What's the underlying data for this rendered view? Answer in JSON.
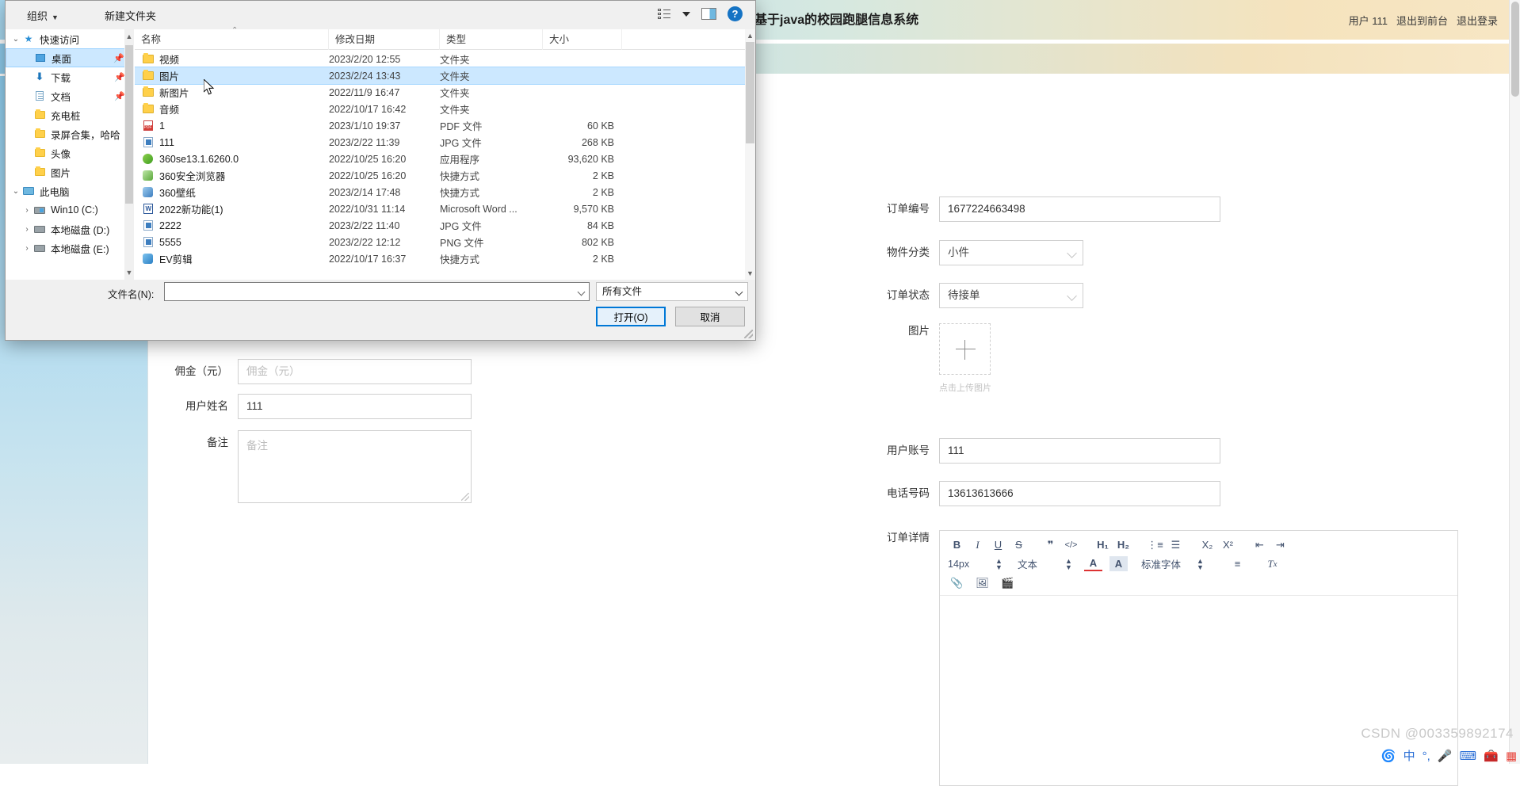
{
  "webpage": {
    "title": "基于java的校园跑腿信息系统",
    "user_label": "用户 111",
    "logout_front": "退出到前台",
    "logout": "退出登录",
    "form_left": {
      "commission_label": "佣金（元）",
      "commission_placeholder": "佣金（元）",
      "commission_value": "",
      "username_label": "用户姓名",
      "username_value": "111",
      "remark_label": "备注",
      "remark_placeholder": "备注",
      "remark_value": ""
    },
    "form_right": {
      "order_no_label": "订单编号",
      "order_no_value": "1677224663498",
      "category_label": "物件分类",
      "category_value": "小件",
      "status_label": "订单状态",
      "status_value": "待接单",
      "image_label": "图片",
      "upload_hint": "点击上传图片",
      "account_label": "用户账号",
      "account_value": "111",
      "phone_label": "电话号码",
      "phone_value": "13613613666",
      "detail_label": "订单详情"
    },
    "editor_toolbar": {
      "row1": [
        "B",
        "I",
        "U",
        "S",
        "❞",
        "</>",
        "H₁",
        "H₂",
        "⋮≡",
        "☰",
        "X₂",
        "X²",
        "⇤",
        "⇥"
      ],
      "font_size": "14px",
      "block_type": "文本",
      "font_family": "标准字体",
      "row3": [
        "paperclip-icon",
        "image-icon",
        "video-icon"
      ]
    }
  },
  "dialog": {
    "toolbar": {
      "organize": "组织",
      "new_folder": "新建文件夹"
    },
    "nav_items": [
      {
        "label": "快速访问",
        "icon": "star-icon",
        "chevron": "⌄",
        "indent": 0,
        "pinned": false,
        "selected": false
      },
      {
        "label": "桌面",
        "icon": "desktop-icon",
        "chevron": "",
        "indent": 1,
        "pinned": true,
        "selected": true
      },
      {
        "label": "下载",
        "icon": "download-icon",
        "chevron": "",
        "indent": 1,
        "pinned": true,
        "selected": false
      },
      {
        "label": "文档",
        "icon": "document-icon",
        "chevron": "",
        "indent": 1,
        "pinned": true,
        "selected": false
      },
      {
        "label": "充电桩",
        "icon": "folder-icon",
        "chevron": "",
        "indent": 1,
        "pinned": false,
        "selected": false
      },
      {
        "label": "录屏合集，哈哈",
        "icon": "folder-icon",
        "chevron": "",
        "indent": 1,
        "pinned": false,
        "selected": false
      },
      {
        "label": "头像",
        "icon": "folder-icon",
        "chevron": "",
        "indent": 1,
        "pinned": false,
        "selected": false
      },
      {
        "label": "图片",
        "icon": "folder-icon",
        "chevron": "",
        "indent": 1,
        "pinned": false,
        "selected": false
      },
      {
        "label": "此电脑",
        "icon": "pc-icon",
        "chevron": "⌄",
        "indent": 0,
        "pinned": false,
        "selected": false
      },
      {
        "label": "Win10 (C:)",
        "icon": "drive-win-icon",
        "chevron": "›",
        "indent": 1,
        "pinned": false,
        "selected": false
      },
      {
        "label": "本地磁盘 (D:)",
        "icon": "drive-icon",
        "chevron": "›",
        "indent": 1,
        "pinned": false,
        "selected": false
      },
      {
        "label": "本地磁盘 (E:)",
        "icon": "drive-icon",
        "chevron": "›",
        "indent": 1,
        "pinned": false,
        "selected": false
      }
    ],
    "columns": [
      "名称",
      "修改日期",
      "类型",
      "大小"
    ],
    "rows": [
      {
        "name": "视频",
        "date": "2023/2/20 12:55",
        "type": "文件夹",
        "size": "",
        "icon": "folder-icon",
        "selected": false
      },
      {
        "name": "图片",
        "date": "2023/2/24 13:43",
        "type": "文件夹",
        "size": "",
        "icon": "folder-icon",
        "selected": true
      },
      {
        "name": "新图片",
        "date": "2022/11/9 16:47",
        "type": "文件夹",
        "size": "",
        "icon": "folder-icon",
        "selected": false
      },
      {
        "name": "音频",
        "date": "2022/10/17 16:42",
        "type": "文件夹",
        "size": "",
        "icon": "folder-icon",
        "selected": false
      },
      {
        "name": "1",
        "date": "2023/1/10 19:37",
        "type": "PDF 文件",
        "size": "60 KB",
        "icon": "pdf-icon",
        "selected": false
      },
      {
        "name": "111",
        "date": "2023/2/22 11:39",
        "type": "JPG 文件",
        "size": "268 KB",
        "icon": "image-file-icon",
        "selected": false
      },
      {
        "name": "360se13.1.6260.0",
        "date": "2022/10/25 16:20",
        "type": "应用程序",
        "size": "93,620 KB",
        "icon": "app-green-icon",
        "selected": false
      },
      {
        "name": "360安全浏览器",
        "date": "2022/10/25 16:20",
        "type": "快捷方式",
        "size": "2 KB",
        "icon": "browser-360-icon",
        "selected": false
      },
      {
        "name": "360壁纸",
        "date": "2023/2/14 17:48",
        "type": "快捷方式",
        "size": "2 KB",
        "icon": "wallpaper-360-icon",
        "selected": false
      },
      {
        "name": "2022新功能(1)",
        "date": "2022/10/31 11:14",
        "type": "Microsoft Word ...",
        "size": "9,570 KB",
        "icon": "word-icon",
        "selected": false
      },
      {
        "name": "2222",
        "date": "2023/2/22 11:40",
        "type": "JPG 文件",
        "size": "84 KB",
        "icon": "image-file-icon",
        "selected": false
      },
      {
        "name": "5555",
        "date": "2023/2/22 12:12",
        "type": "PNG 文件",
        "size": "802 KB",
        "icon": "image-file-icon",
        "selected": false
      },
      {
        "name": "EV剪辑",
        "date": "2022/10/17 16:37",
        "type": "快捷方式",
        "size": "2 KB",
        "icon": "ev-icon",
        "selected": false
      }
    ],
    "footer": {
      "filename_label": "文件名(N):",
      "filename_value": "",
      "filetype_value": "所有文件",
      "open_button": "打开(O)",
      "cancel_button": "取消"
    }
  },
  "watermark": "CSDN @003359892174"
}
